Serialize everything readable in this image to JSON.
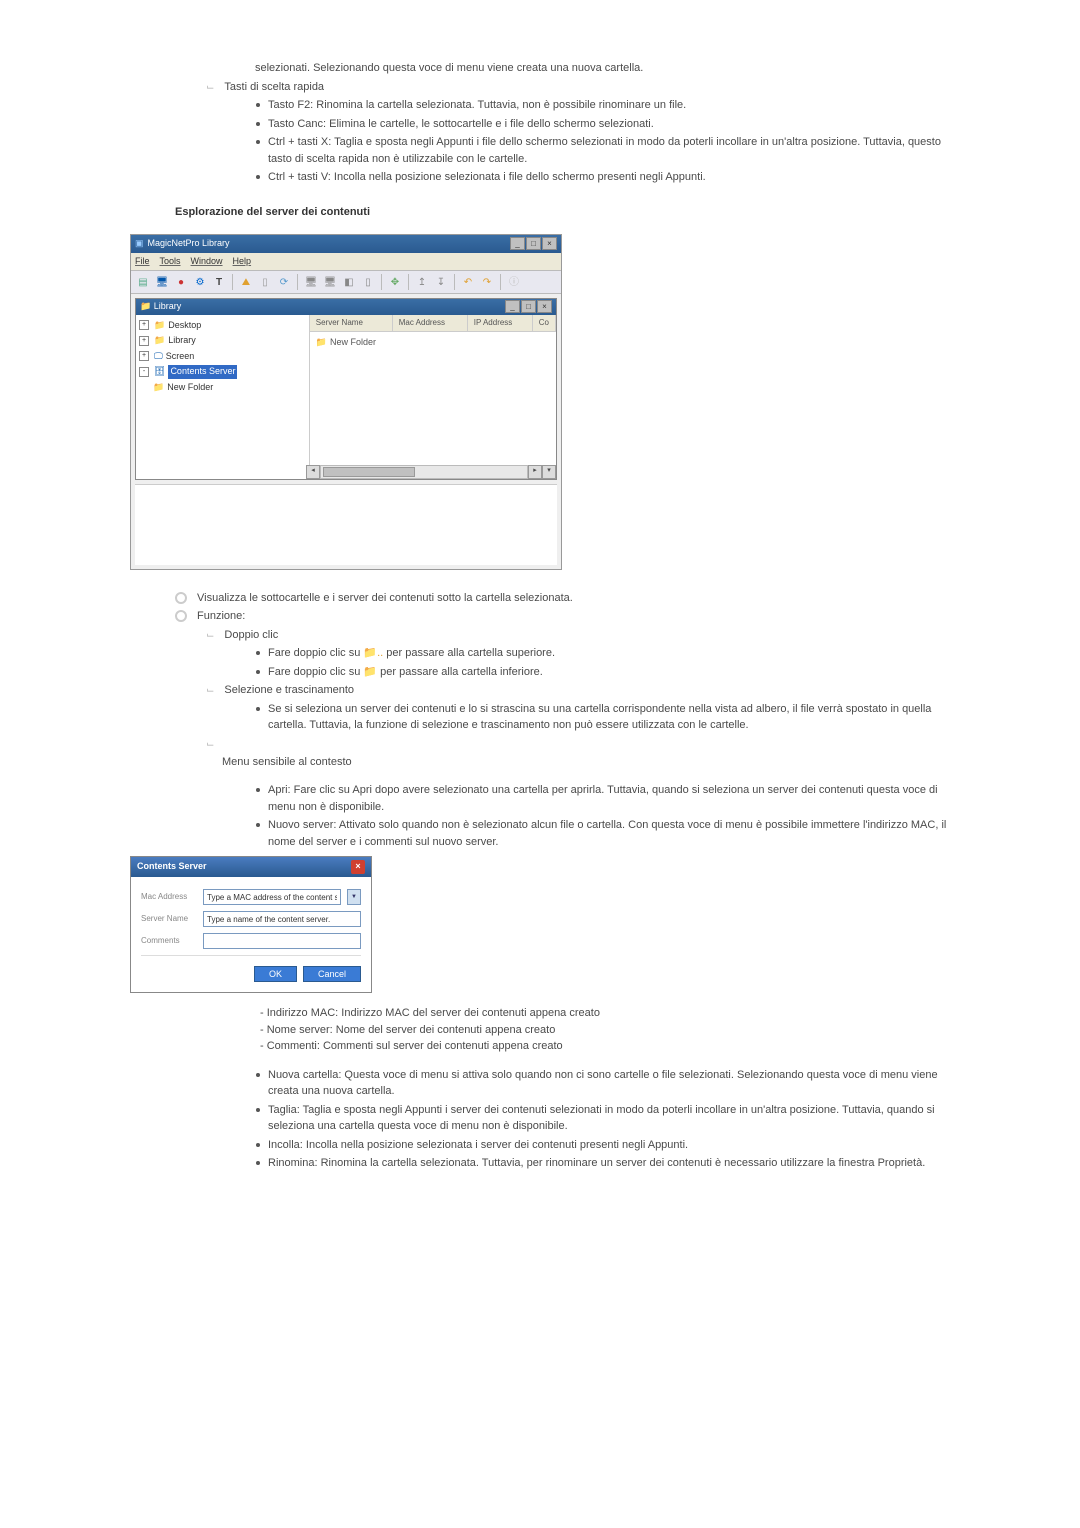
{
  "intro": {
    "line0": "selezionati. Selezionando questa voce di menu viene creata una nuova cartella.",
    "shortcut_heading": "Tasti di scelta rapida",
    "sc1": "Tasto F2: Rinomina la cartella selezionata. Tuttavia, non è possibile rinominare un file.",
    "sc2": "Tasto Canc: Elimina le cartelle, le sottocartelle e i file dello schermo selezionati.",
    "sc3": "Ctrl + tasti X: Taglia e sposta negli Appunti i file dello schermo selezionati in modo da poterli incollare in un'altra posizione. Tuttavia, questo tasto di scelta rapida non è utilizzabile con le cartelle.",
    "sc4": "Ctrl + tasti V: Incolla nella posizione selezionata i file dello schermo presenti negli Appunti."
  },
  "section_title": "Esplorazione del server dei contenuti",
  "shot1": {
    "app_title": "MagicNetPro Library",
    "menus": [
      "File",
      "Tools",
      "Window",
      "Help"
    ],
    "sub_title": "Library",
    "tree": {
      "desktop": "Desktop",
      "library": "Library",
      "screen": "Screen",
      "contents_server": "Contents Server",
      "new_folder": "New Folder"
    },
    "columns": {
      "c1": "Server Name",
      "c2": "Mac Address",
      "c3": "IP Address",
      "c4": "Co"
    },
    "list_row": "New Folder"
  },
  "below": {
    "l1": "Visualizza le sottocartelle e i server dei contenuti sotto la cartella selezionata.",
    "l2": "Funzione:",
    "dbl": "Doppio clic",
    "dbl_a_pre": "Fare doppio clic su ",
    "dbl_a_post": " per passare alla cartella superiore.",
    "dbl_b_pre": "Fare doppio clic su ",
    "dbl_b_post": " per passare alla cartella inferiore.",
    "sel": "Selezione e trascinamento",
    "sel_a": "Se si seleziona un server dei contenuti e lo si strascina su una cartella corrispondente nella vista ad albero, il file verrà spostato in quella cartella. Tuttavia, la funzione di selezione e trascinamento non può essere utilizzata con le cartelle.",
    "ctx": "Menu sensibile al contesto",
    "ctx_a": "Apri: Fare clic su Apri dopo avere selezionato una cartella per aprirla. Tuttavia, quando si seleziona un server dei contenuti questa voce di menu non è disponibile.",
    "ctx_b": "Nuovo server: Attivato solo quando non è selezionato alcun file o cartella. Con questa voce di menu è possibile immettere l'indirizzo MAC, il nome del server e i commenti sul nuovo server."
  },
  "dialog": {
    "title": "Contents Server",
    "mac_lbl": "Mac Address",
    "mac_ph": "Type a MAC address of the content server",
    "name_lbl": "Server Name",
    "name_ph": "Type a name of the content server.",
    "comments_lbl": "Comments",
    "ok": "OK",
    "cancel": "Cancel"
  },
  "defs": {
    "d1": "- Indirizzo MAC: Indirizzo MAC del server dei contenuti appena creato",
    "d2": "- Nome server: Nome del server dei contenuti appena creato",
    "d3": "- Commenti: Commenti sul server dei contenuti appena creato"
  },
  "ctx_more": {
    "m1": "Nuova cartella: Questa voce di menu si attiva solo quando non ci sono cartelle o file selezionati. Selezionando questa voce di menu viene creata una nuova cartella.",
    "m2": "Taglia: Taglia e sposta negli Appunti i server dei contenuti selezionati in modo da poterli incollare in un'altra posizione. Tuttavia, quando si seleziona una cartella questa voce di menu non è disponibile.",
    "m3": "Incolla: Incolla nella posizione selezionata i server dei contenuti presenti negli Appunti.",
    "m4": "Rinomina: Rinomina la cartella selezionata. Tuttavia, per rinominare un server dei contenuti è necessario utilizzare la finestra Proprietà."
  }
}
